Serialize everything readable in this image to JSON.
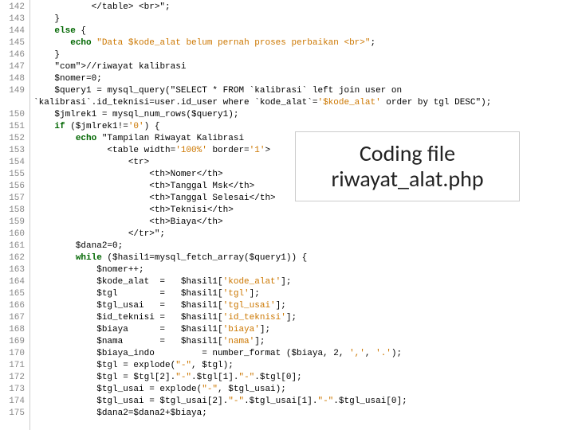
{
  "line_numbers": [
    "142",
    "143",
    "144",
    "145",
    "146",
    "147",
    "148",
    "149",
    "",
    "150",
    "151",
    "152",
    "153",
    "154",
    "155",
    "156",
    "157",
    "158",
    "159",
    "160",
    "161",
    "162",
    "163",
    "164",
    "165",
    "166",
    "167",
    "168",
    "169",
    "170",
    "171",
    "172",
    "173",
    "174",
    "175"
  ],
  "code_lines": [
    {
      "i": "           ",
      "t": "</table> <br>\";"
    },
    {
      "i": "    ",
      "t": "}"
    },
    {
      "i": "    ",
      "t": "else {"
    },
    {
      "i": "       ",
      "t": "echo \"Data $kode_alat belum pernah proses perbaikan <br>\";"
    },
    {
      "i": "    ",
      "t": "}"
    },
    {
      "i": "    ",
      "t": "//riwayat kalibrasi"
    },
    {
      "i": "    ",
      "t": "$nomer=0;"
    },
    {
      "i": "    ",
      "t": "$query1 = mysql_query(\"SELECT * FROM `kalibrasi` left join user on"
    },
    {
      "i": "",
      "t": "`kalibrasi`.id_teknisi=user.id_user where `kode_alat`='$kode_alat' order by tgl DESC\");"
    },
    {
      "i": "    ",
      "t": "$jmlrek1 = mysql_num_rows($query1);"
    },
    {
      "i": "    ",
      "t": "if ($jmlrek1!='0') {"
    },
    {
      "i": "        ",
      "t": "echo \"Tampilan Riwayat Kalibrasi"
    },
    {
      "i": "              ",
      "t": "<table width='100%' border='1'>"
    },
    {
      "i": "                  ",
      "t": "<tr>"
    },
    {
      "i": "                      ",
      "t": "<th>Nomer</th>"
    },
    {
      "i": "                      ",
      "t": "<th>Tanggal Msk</th>"
    },
    {
      "i": "                      ",
      "t": "<th>Tanggal Selesai</th>"
    },
    {
      "i": "                      ",
      "t": "<th>Teknisi</th>"
    },
    {
      "i": "                      ",
      "t": "<th>Biaya</th>"
    },
    {
      "i": "                  ",
      "t": "</tr>\";"
    },
    {
      "i": "        ",
      "t": "$dana2=0;"
    },
    {
      "i": "        ",
      "t": "while ($hasil1=mysql_fetch_array($query1)) {"
    },
    {
      "i": "            ",
      "t": "$nomer++;"
    },
    {
      "i": "            ",
      "t": "$kode_alat  =   $hasil1['kode_alat'];"
    },
    {
      "i": "            ",
      "t": "$tgl        =   $hasil1['tgl'];"
    },
    {
      "i": "            ",
      "t": "$tgl_usai   =   $hasil1['tgl_usai'];"
    },
    {
      "i": "            ",
      "t": "$id_teknisi =   $hasil1['id_teknisi'];"
    },
    {
      "i": "            ",
      "t": "$biaya      =   $hasil1['biaya'];"
    },
    {
      "i": "            ",
      "t": "$nama       =   $hasil1['nama'];"
    },
    {
      "i": "            ",
      "t": "$biaya_indo         = number_format ($biaya, 2, ',', '.');"
    },
    {
      "i": "            ",
      "t": "$tgl = explode(\"-\", $tgl);"
    },
    {
      "i": "            ",
      "t": "$tgl = $tgl[2].\"-\".$tgl[1].\"-\".$tgl[0];"
    },
    {
      "i": "            ",
      "t": "$tgl_usai = explode(\"-\", $tgl_usai);"
    },
    {
      "i": "            ",
      "t": "$tgl_usai = $tgl_usai[2].\"-\".$tgl_usai[1].\"-\".$tgl_usai[0];"
    },
    {
      "i": "            ",
      "t": "$dana2=$dana2+$biaya;"
    }
  ],
  "caption": "Coding file riwayat_alat.php"
}
